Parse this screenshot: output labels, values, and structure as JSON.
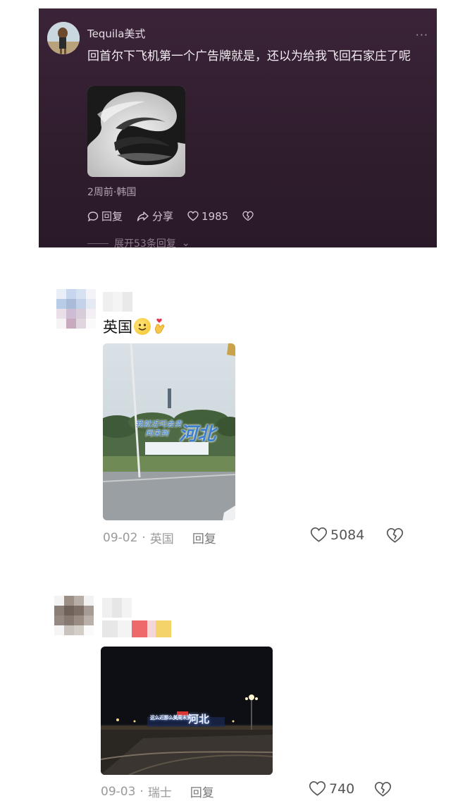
{
  "top_comment": {
    "username": "Tequila美式",
    "more_icon": "more-dots-icon",
    "text": "回首尔下飞机第一个广告牌就是，还以为给我飞回石家庄了呢",
    "meta": "2周前·韩国",
    "reply_label": "回复",
    "share_label": "分享",
    "likes": "1985",
    "expand_label": "展开53条回复"
  },
  "comments": [
    {
      "text": "英国",
      "date": "09-02",
      "location": "英国",
      "reply_label": "回复",
      "likes": "5084",
      "media": {
        "sign_line1": "我就近吗会卖",
        "sign_line2": "同来到",
        "sign_big": "河北"
      }
    },
    {
      "date": "09-03",
      "location": "瑞士",
      "reply_label": "回复",
      "likes": "740",
      "media": {
        "sign_line1": "这么近那么美周末到",
        "sign_big": "河北"
      }
    }
  ],
  "colors": {
    "dark_card_bg": "#2f1d2d",
    "meta_gray": "#9a9a9a",
    "heart_outline": "#555555"
  }
}
